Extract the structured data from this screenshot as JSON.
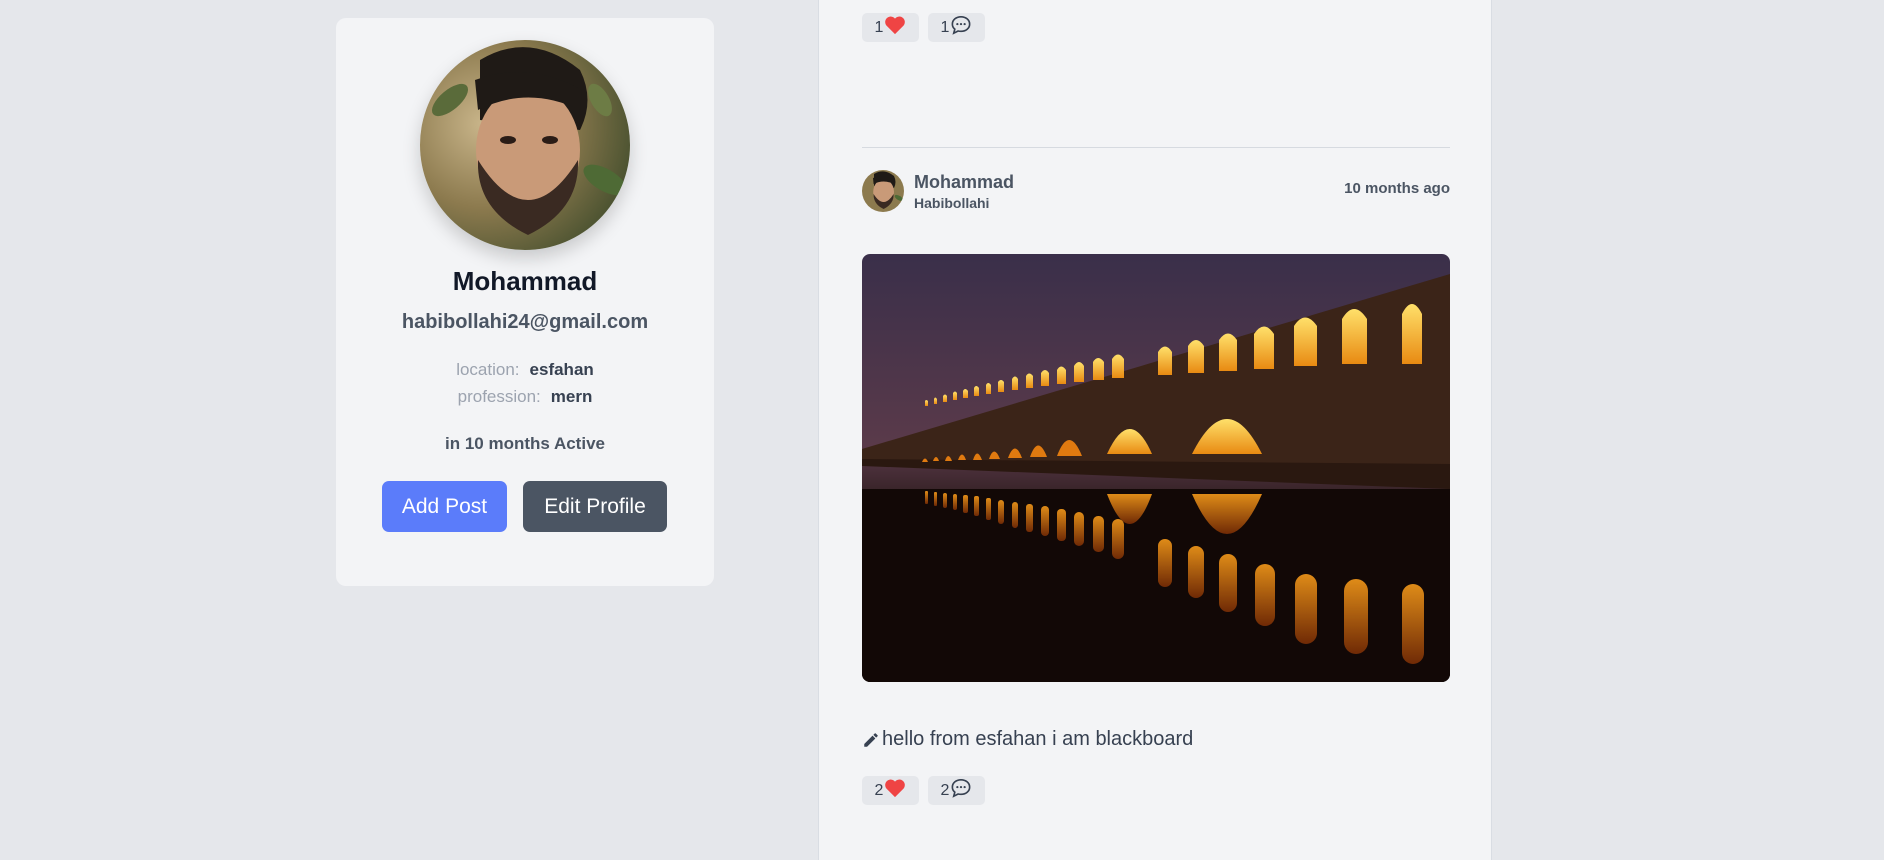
{
  "profile": {
    "name": "Mohammad",
    "email": "habibollahi24@gmail.com",
    "location_label": "location:",
    "location_value": "esfahan",
    "profession_label": "profession:",
    "profession_value": "mern",
    "active_text": "in 10 months Active",
    "add_post_label": "Add Post",
    "edit_profile_label": "Edit Profile"
  },
  "feed": {
    "previous_post": {
      "likes": "1",
      "comments": "1"
    },
    "post": {
      "author_first": "Mohammad",
      "author_last": "Habibollahi",
      "time": "10 months ago",
      "text": "hello from esfahan i am blackboard",
      "likes": "2",
      "comments": "2"
    }
  },
  "icons": {
    "like": "heart-icon",
    "comment": "chat-bubble-icon",
    "edit": "pencil-icon"
  },
  "colors": {
    "primary": "#5b7cfa",
    "secondary": "#4b5563",
    "heart": "#ef4444"
  }
}
